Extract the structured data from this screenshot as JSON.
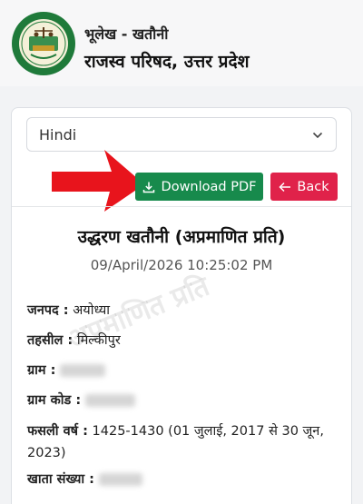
{
  "header": {
    "subtitle": "भूलेख - खतौनी",
    "title": "राजस्व परिषद, उत्तर प्रदेश",
    "logo_text": "राजस्व परिषद, उ.प्र."
  },
  "language_select": {
    "selected": "Hindi"
  },
  "actions": {
    "download_label": "Download PDF",
    "back_label": "Back"
  },
  "document": {
    "title": "उद्धरण खतौनी (अप्रमाणित प्रति)",
    "datetime": "09/April/2026 10:25:02 PM",
    "watermark": "अप्रमाणित प्रति",
    "fields": {
      "janpad_label": "जनपद :",
      "janpad_value": "अयोध्या",
      "tehsil_label": "तहसील :",
      "tehsil_value": "मिल्कीपुर",
      "gram_label": "ग्राम :",
      "gram_code_label": "ग्राम कोड :",
      "fasli_label": "फसली वर्ष :",
      "fasli_value": "1425-1430 (01 जुलाई, 2017 से 30 जून, 2023)",
      "khata_label": "खाता संख्या :"
    }
  },
  "colors": {
    "download_bg": "#178a4c",
    "back_bg": "#e0224a",
    "arrow": "#e8141c"
  }
}
